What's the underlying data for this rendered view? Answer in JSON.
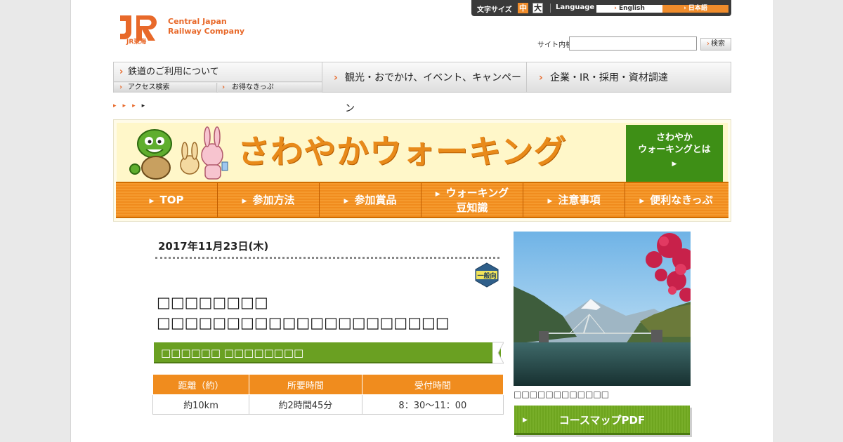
{
  "header": {
    "company_line1": "Central Japan",
    "company_line2": "Railway Company",
    "logo_sub": "JR東海",
    "font_size_label": "文字サイズ",
    "font_size_mid": "中",
    "font_size_big": "大",
    "language_label": "Language",
    "lang_english": "English",
    "lang_japanese": "日本語",
    "search_label": "サイト内検索",
    "search_value": "",
    "search_button": "検索"
  },
  "global_nav": {
    "railway": "鉄道のご利用について",
    "access": "アクセス検索",
    "tickets": "お得なきっぷ",
    "tourism": "観光・おでかけ、イベント、キャンペーン",
    "corporate": "企業・IR・採用・資材調達"
  },
  "breadcrumb_arrows": [
    "▸",
    "▸",
    "▸",
    "▸"
  ],
  "banner": {
    "title": "さわやかウォーキング",
    "about_line1": "さわやか",
    "about_line2": "ウォーキングとは",
    "tabs": [
      "TOP",
      "参加方法",
      "参加賞品",
      "ウォーキング",
      "豆知識",
      "注意事項",
      "便利なきっぷ"
    ]
  },
  "event": {
    "date": "2017年11月23日(木)",
    "badge": "一般向",
    "title_line1": "□□□□□□□□",
    "title_line2": "□□□□□□□□□□□□□□□□□□□□□",
    "station": "□□□□□□ □□□□□□□□",
    "table_headers": [
      "距離（約）",
      "所要時間",
      "受付時間"
    ],
    "table_values": [
      "約10km",
      "約2時間45分",
      "8：30～11：00"
    ]
  },
  "photo": {
    "caption": "□□□□□□□□□□□□",
    "pdf_button": "コースマップPDF"
  },
  "colors": {
    "accent_orange": "#f08c1e",
    "accent_green": "#6aa022"
  }
}
